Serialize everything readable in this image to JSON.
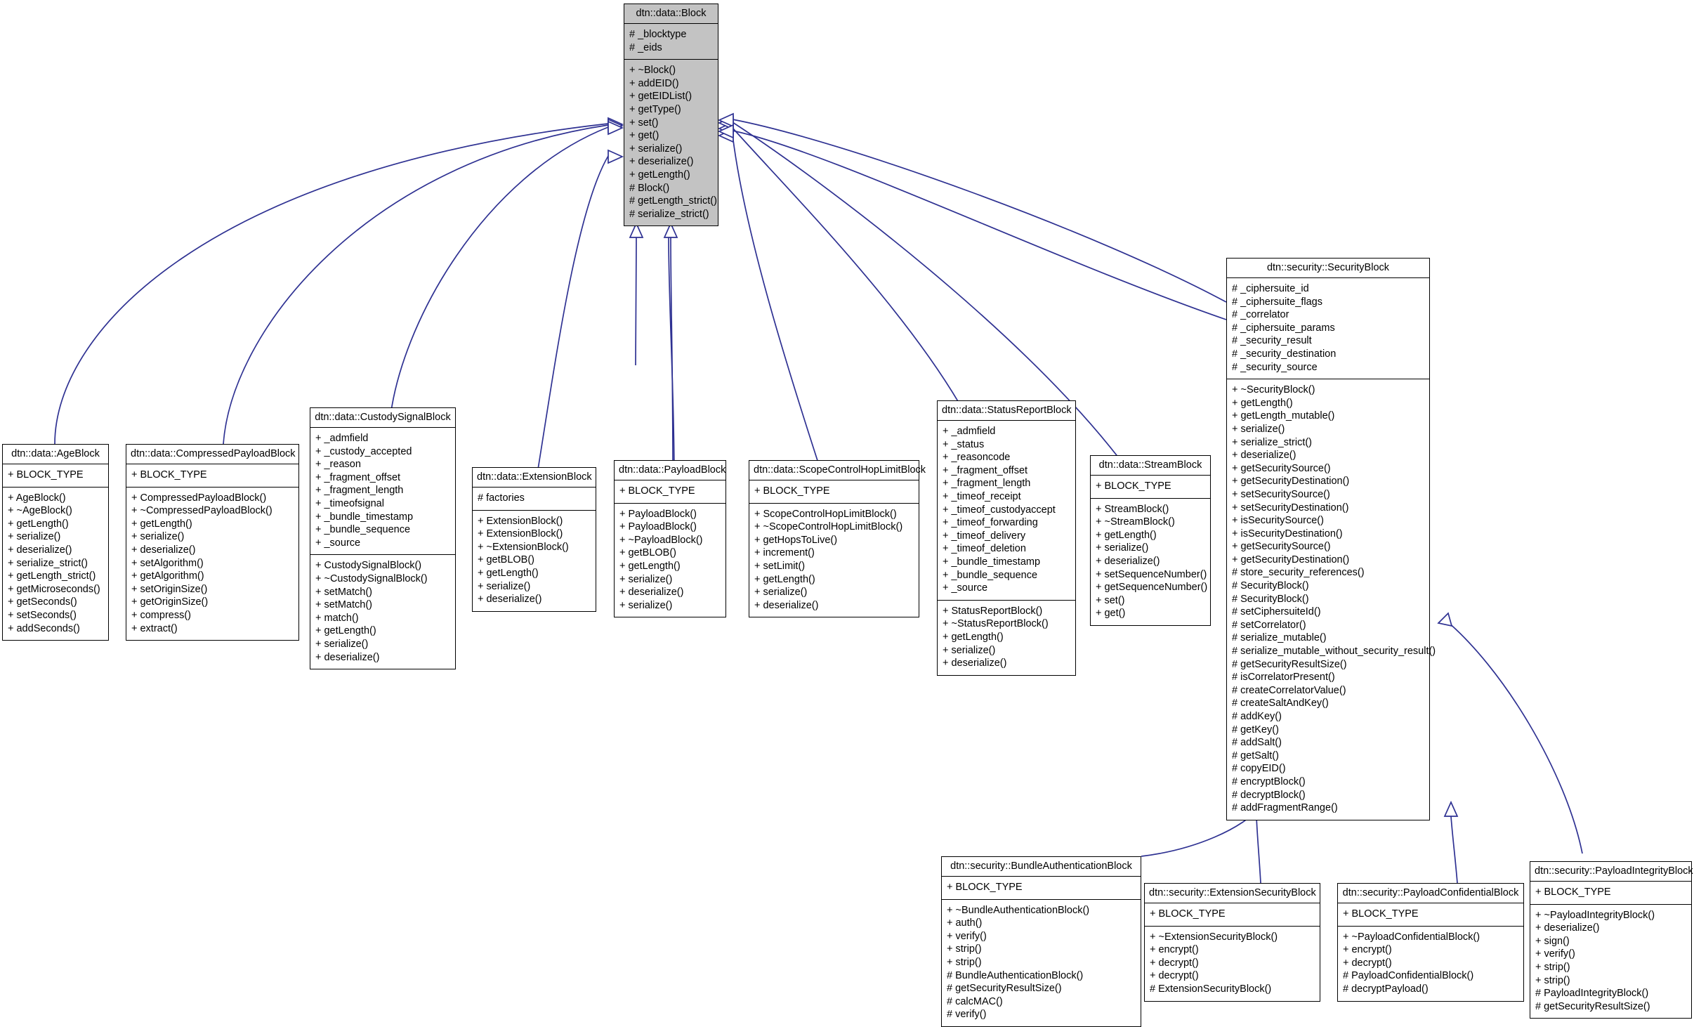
{
  "diagram": {
    "kind": "uml-class-inheritance",
    "root": "dtn::data::Block",
    "accent_color": "#2e3192",
    "root_fill": "#c3c3c3",
    "box_fill": "#ffffff",
    "border_color": "#000000"
  },
  "classes": {
    "block": {
      "name": "dtn::data::Block",
      "attributes": [
        "# _blocktype",
        "# _eids"
      ],
      "operations": [
        "+ ~Block()",
        "+ addEID()",
        "+ getEIDList()",
        "+ getType()",
        "+ set()",
        "+ get()",
        "+ serialize()",
        "+ deserialize()",
        "+ getLength()",
        "# Block()",
        "# getLength_strict()",
        "# serialize_strict()"
      ]
    },
    "age_block": {
      "name": "dtn::data::AgeBlock",
      "attributes": [
        "+ BLOCK_TYPE"
      ],
      "operations": [
        "+ AgeBlock()",
        "+ ~AgeBlock()",
        "+ getLength()",
        "+ serialize()",
        "+ deserialize()",
        "+ serialize_strict()",
        "+ getLength_strict()",
        "+ getMicroseconds()",
        "+ getSeconds()",
        "+ setSeconds()",
        "+ addSeconds()"
      ]
    },
    "compressed_payload_block": {
      "name": "dtn::data::CompressedPayloadBlock",
      "attributes": [
        "+ BLOCK_TYPE"
      ],
      "operations": [
        "+ CompressedPayloadBlock()",
        "+ ~CompressedPayloadBlock()",
        "+ getLength()",
        "+ serialize()",
        "+ deserialize()",
        "+ setAlgorithm()",
        "+ getAlgorithm()",
        "+ setOriginSize()",
        "+ getOriginSize()",
        "+ compress()",
        "+ extract()"
      ]
    },
    "custody_signal_block": {
      "name": "dtn::data::CustodySignalBlock",
      "attributes": [
        "+ _admfield",
        "+ _custody_accepted",
        "+ _reason",
        "+ _fragment_offset",
        "+ _fragment_length",
        "+ _timeofsignal",
        "+ _bundle_timestamp",
        "+ _bundle_sequence",
        "+ _source"
      ],
      "operations": [
        "+ CustodySignalBlock()",
        "+ ~CustodySignalBlock()",
        "+ setMatch()",
        "+ setMatch()",
        "+ match()",
        "+ getLength()",
        "+ serialize()",
        "+ deserialize()"
      ]
    },
    "extension_block": {
      "name": "dtn::data::ExtensionBlock",
      "attributes": [
        "# factories"
      ],
      "operations": [
        "+ ExtensionBlock()",
        "+ ExtensionBlock()",
        "+ ~ExtensionBlock()",
        "+ getBLOB()",
        "+ getLength()",
        "+ serialize()",
        "+ deserialize()"
      ]
    },
    "payload_block": {
      "name": "dtn::data::PayloadBlock",
      "attributes": [
        "+ BLOCK_TYPE"
      ],
      "operations": [
        "+ PayloadBlock()",
        "+ PayloadBlock()",
        "+ ~PayloadBlock()",
        "+ getBLOB()",
        "+ getLength()",
        "+ serialize()",
        "+ deserialize()",
        "+ serialize()"
      ]
    },
    "scope_control_hop_limit_block": {
      "name": "dtn::data::ScopeControlHopLimitBlock",
      "attributes": [
        "+ BLOCK_TYPE"
      ],
      "operations": [
        "+ ScopeControlHopLimitBlock()",
        "+ ~ScopeControlHopLimitBlock()",
        "+ getHopsToLive()",
        "+ increment()",
        "+ setLimit()",
        "+ getLength()",
        "+ serialize()",
        "+ deserialize()"
      ]
    },
    "status_report_block": {
      "name": "dtn::data::StatusReportBlock",
      "attributes": [
        "+ _admfield",
        "+ _status",
        "+ _reasoncode",
        "+ _fragment_offset",
        "+ _fragment_length",
        "+ _timeof_receipt",
        "+ _timeof_custodyaccept",
        "+ _timeof_forwarding",
        "+ _timeof_delivery",
        "+ _timeof_deletion",
        "+ _bundle_timestamp",
        "+ _bundle_sequence",
        "+ _source"
      ],
      "operations": [
        "+ StatusReportBlock()",
        "+ ~StatusReportBlock()",
        "+ getLength()",
        "+ serialize()",
        "+ deserialize()"
      ]
    },
    "stream_block": {
      "name": "dtn::data::StreamBlock",
      "attributes": [
        "+ BLOCK_TYPE"
      ],
      "operations": [
        "+ StreamBlock()",
        "+ ~StreamBlock()",
        "+ getLength()",
        "+ serialize()",
        "+ deserialize()",
        "+ setSequenceNumber()",
        "+ getSequenceNumber()",
        "+ set()",
        "+ get()"
      ]
    },
    "security_block": {
      "name": "dtn::security::SecurityBlock",
      "attributes": [
        "# _ciphersuite_id",
        "# _ciphersuite_flags",
        "# _correlator",
        "# _ciphersuite_params",
        "# _security_result",
        "# _security_destination",
        "# _security_source"
      ],
      "operations": [
        "+ ~SecurityBlock()",
        "+ getLength()",
        "+ getLength_mutable()",
        "+ serialize()",
        "+ serialize_strict()",
        "+ deserialize()",
        "+ getSecuritySource()",
        "+ getSecurityDestination()",
        "+ setSecuritySource()",
        "+ setSecurityDestination()",
        "+ isSecuritySource()",
        "+ isSecurityDestination()",
        "+ getSecuritySource()",
        "+ getSecurityDestination()",
        "# store_security_references()",
        "# SecurityBlock()",
        "# SecurityBlock()",
        "# setCiphersuiteId()",
        "# setCorrelator()",
        "# serialize_mutable()",
        "# serialize_mutable_without_security_result()",
        "# getSecurityResultSize()",
        "# isCorrelatorPresent()",
        "# createCorrelatorValue()",
        "# createSaltAndKey()",
        "# addKey()",
        "# getKey()",
        "# addSalt()",
        "# getSalt()",
        "# copyEID()",
        "# encryptBlock()",
        "# decryptBlock()",
        "# addFragmentRange()"
      ]
    },
    "bundle_authentication_block": {
      "name": "dtn::security::BundleAuthenticationBlock",
      "attributes": [
        "+ BLOCK_TYPE"
      ],
      "operations": [
        "+ ~BundleAuthenticationBlock()",
        "+ auth()",
        "+ verify()",
        "+ strip()",
        "+ strip()",
        "# BundleAuthenticationBlock()",
        "# getSecurityResultSize()",
        "# calcMAC()",
        "# verify()"
      ]
    },
    "extension_security_block": {
      "name": "dtn::security::ExtensionSecurityBlock",
      "attributes": [
        "+ BLOCK_TYPE"
      ],
      "operations": [
        "+ ~ExtensionSecurityBlock()",
        "+ encrypt()",
        "+ decrypt()",
        "+ decrypt()",
        "# ExtensionSecurityBlock()"
      ]
    },
    "payload_confidential_block": {
      "name": "dtn::security::PayloadConfidentialBlock",
      "attributes": [
        "+ BLOCK_TYPE"
      ],
      "operations": [
        "+ ~PayloadConfidentialBlock()",
        "+ encrypt()",
        "+ decrypt()",
        "# PayloadConfidentialBlock()",
        "# decryptPayload()"
      ]
    },
    "payload_integrity_block": {
      "name": "dtn::security::PayloadIntegrityBlock",
      "attributes": [
        "+ BLOCK_TYPE"
      ],
      "operations": [
        "+ ~PayloadIntegrityBlock()",
        "+ deserialize()",
        "+ sign()",
        "+ verify()",
        "+ strip()",
        "+ strip()",
        "# PayloadIntegrityBlock()",
        "# getSecurityResultSize()"
      ]
    }
  }
}
